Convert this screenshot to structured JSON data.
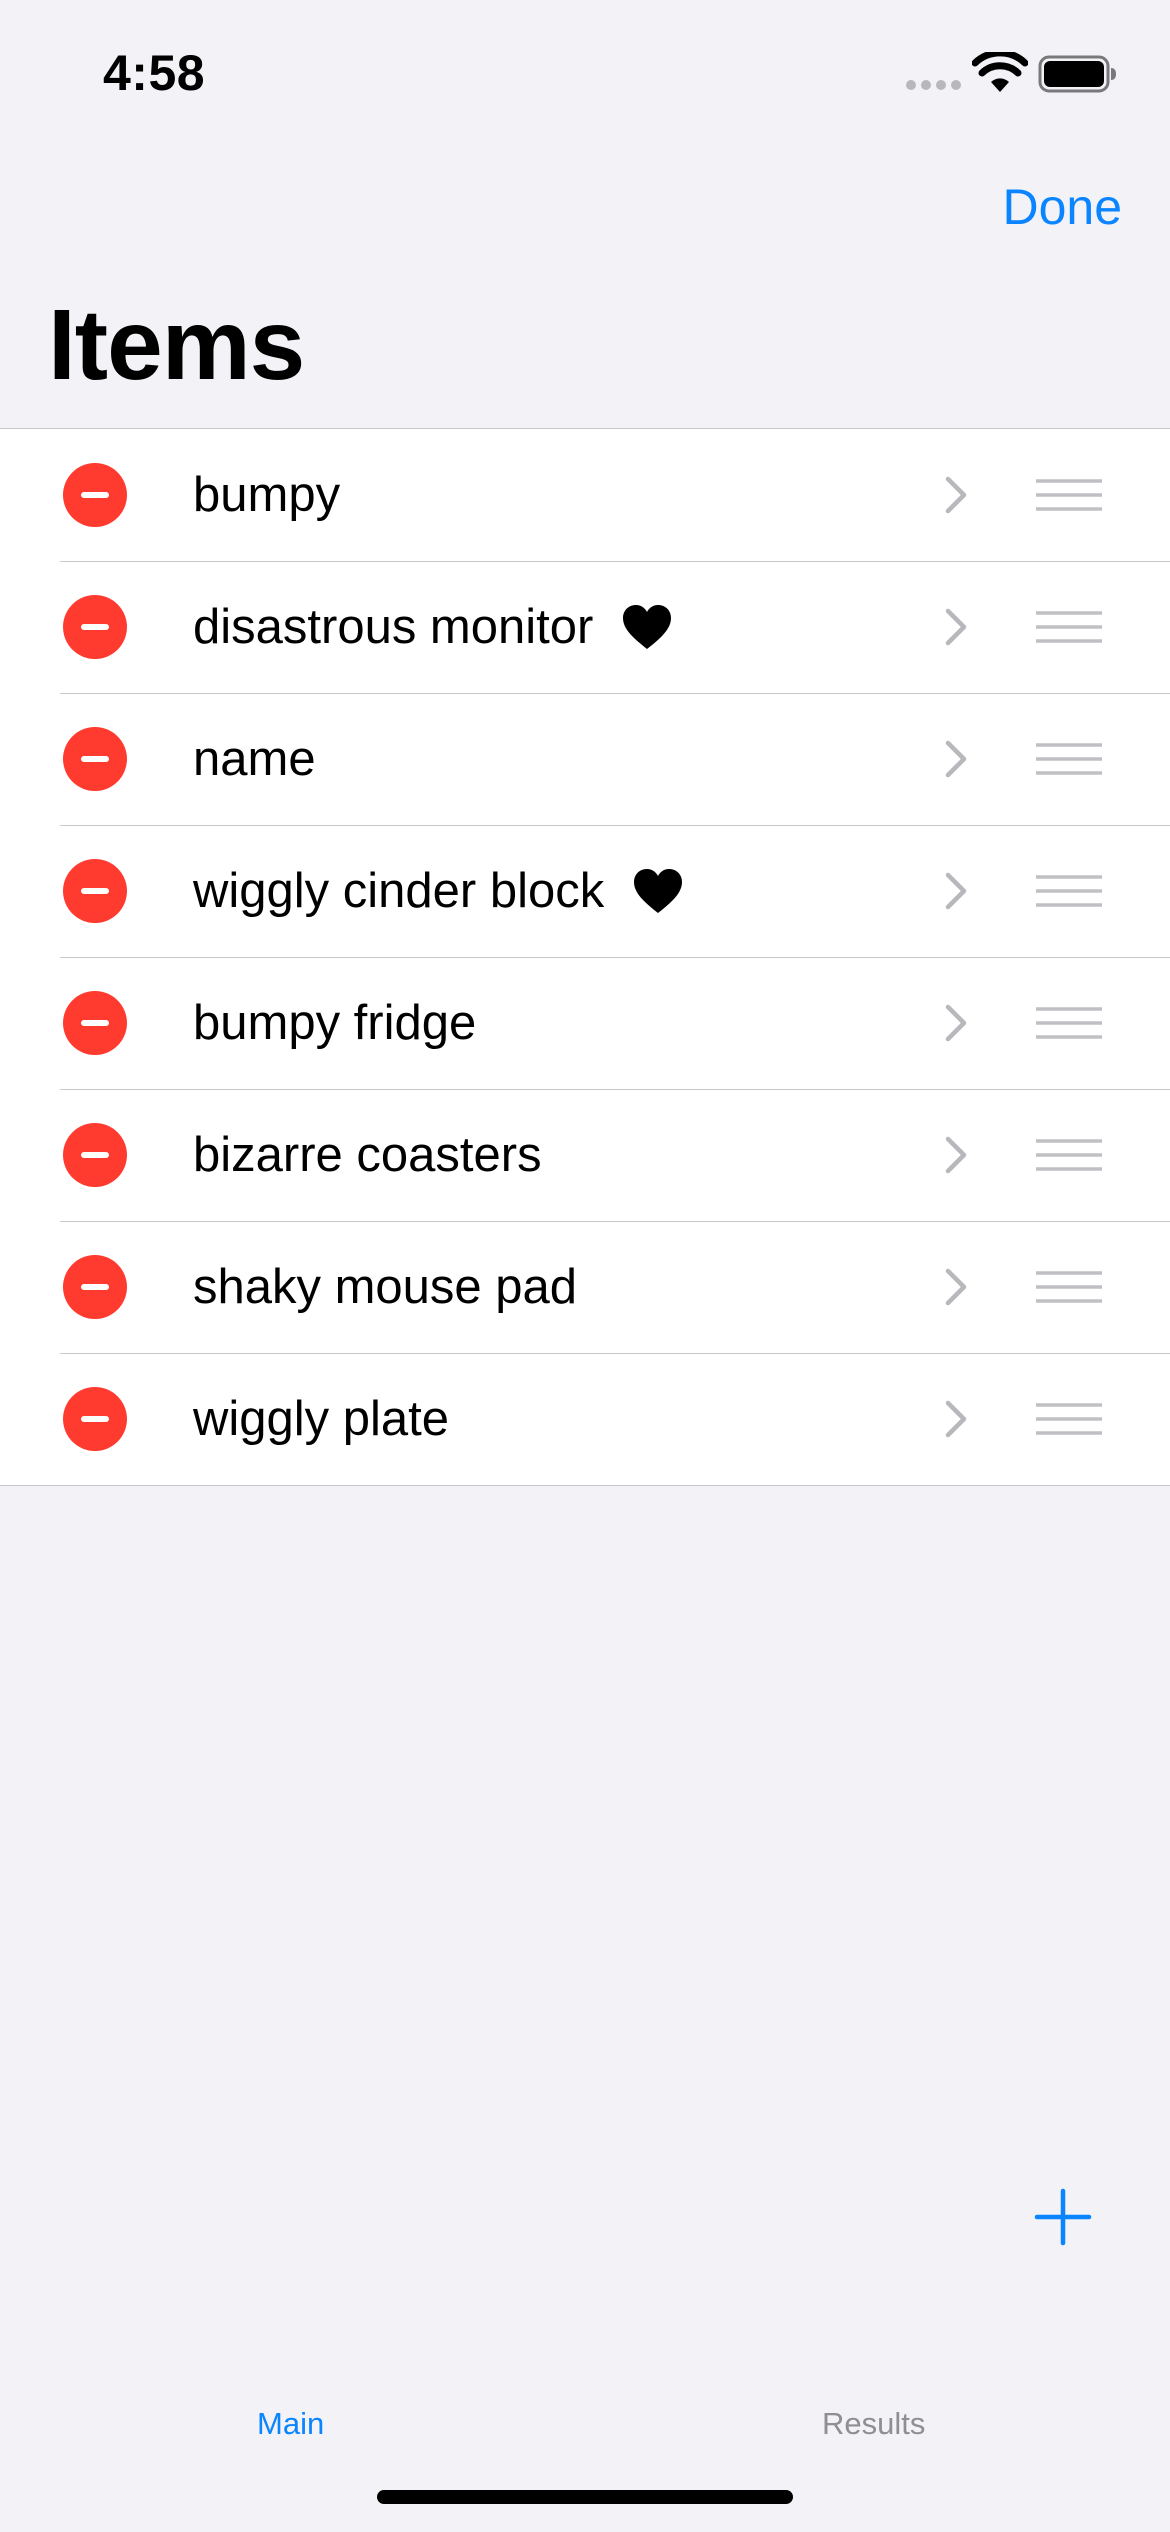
{
  "status_bar": {
    "time": "4:58"
  },
  "nav": {
    "done_label": "Done",
    "title": "Items"
  },
  "items": [
    {
      "label": "bumpy",
      "favorite": false
    },
    {
      "label": "disastrous monitor",
      "favorite": true
    },
    {
      "label": "name",
      "favorite": false
    },
    {
      "label": "wiggly cinder block",
      "favorite": true
    },
    {
      "label": "bumpy fridge",
      "favorite": false
    },
    {
      "label": "bizarre coasters",
      "favorite": false
    },
    {
      "label": "shaky mouse pad",
      "favorite": false
    },
    {
      "label": "wiggly plate",
      "favorite": false
    }
  ],
  "tabs": [
    {
      "label": "Main",
      "selected": true
    },
    {
      "label": "Results",
      "selected": false
    }
  ],
  "colors": {
    "accent": "#0a84ff",
    "delete": "#ff3b30",
    "background": "#f2f2f7",
    "inactive_tab": "#8e8e93"
  },
  "icons": {
    "delete": "minus-circle-icon",
    "favorite": "heart-icon",
    "disclosure": "chevron-right-icon",
    "reorder": "reorder-handle-icon",
    "add": "plus-icon"
  }
}
